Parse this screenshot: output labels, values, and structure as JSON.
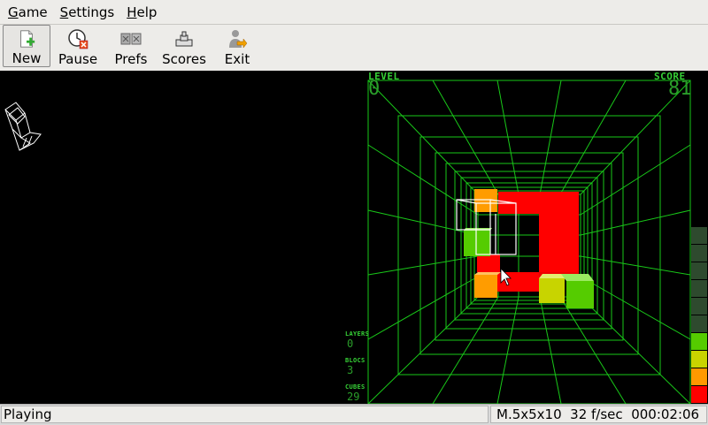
{
  "menu": {
    "game_first": "G",
    "game_rest": "ame",
    "settings_first": "S",
    "settings_rest": "ettings",
    "help_first": "H",
    "help_rest": "elp"
  },
  "toolbar": {
    "new_label": "New",
    "pause_label": "Pause",
    "prefs_label": "Prefs",
    "scores_label": "Scores",
    "exit_label": "Exit"
  },
  "hud": {
    "level_label": "LEVEL",
    "level_value": "0",
    "score_label": "SCORE",
    "score_value": "81",
    "layers_label": "LAYERS",
    "layers_value": "0",
    "blocs_label": "BLOCS",
    "blocs_value": "3",
    "cubes_label": "CUBES",
    "cubes_value": "29"
  },
  "status": {
    "state": "Playing",
    "info": "M.5x5x10  32 f/sec  000:02:06"
  },
  "colors": {
    "grid": "#19c819",
    "layer_colors": [
      "#ff0000",
      "#ff9900",
      "#c8d400",
      "#55cc00",
      "#2e4a2e"
    ]
  },
  "layer_indicator": {
    "filled_levels": 4,
    "total_levels": 10
  }
}
